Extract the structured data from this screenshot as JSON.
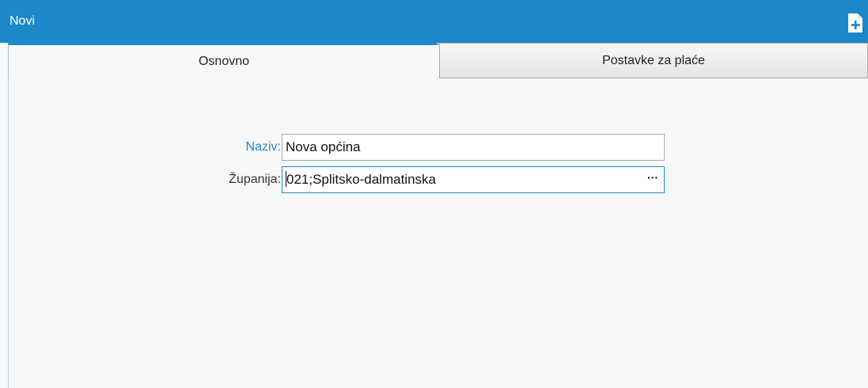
{
  "window": {
    "title": "Novi",
    "new_icon": "new-document-plus-icon"
  },
  "tabs": [
    {
      "label": "Osnovno",
      "active": true
    },
    {
      "label": "Postavke za plaće",
      "active": false
    }
  ],
  "form": {
    "naziv": {
      "label": "Naziv:",
      "value": "Nova općina",
      "required": true
    },
    "zupanija": {
      "label": "Županija:",
      "value": "021;Splitsko-dalmatinska",
      "lookup_label": "···"
    }
  },
  "colors": {
    "titlebar": "#1c87c9",
    "required_label": "#2a86c6",
    "background": "#f6f8fa"
  }
}
